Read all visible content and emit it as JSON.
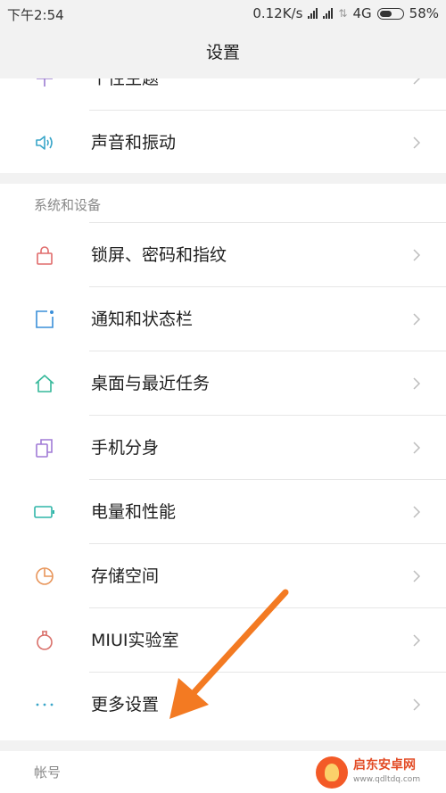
{
  "status_bar": {
    "time": "下午2:54",
    "speed": "0.12K/s",
    "network": "4G",
    "battery": "58%",
    "battery_level": 0.58
  },
  "title": "设置",
  "top_group": {
    "items": [
      {
        "label": "个性主题",
        "icon": "theme-icon",
        "color": "#9b7bd1"
      },
      {
        "label": "声音和振动",
        "icon": "speaker-icon",
        "color": "#3aa6c9"
      }
    ]
  },
  "system_section": {
    "header": "系统和设备",
    "items": [
      {
        "label": "锁屏、密码和指纹",
        "icon": "lock-icon",
        "color": "#e06b6b"
      },
      {
        "label": "通知和状态栏",
        "icon": "notification-icon",
        "color": "#3a8fd9"
      },
      {
        "label": "桌面与最近任务",
        "icon": "home-icon",
        "color": "#35b89a"
      },
      {
        "label": "手机分身",
        "icon": "dual-app-icon",
        "color": "#a07ad6"
      },
      {
        "label": "电量和性能",
        "icon": "battery-icon",
        "color": "#2fb5a8"
      },
      {
        "label": "存储空间",
        "icon": "storage-icon",
        "color": "#e8955a"
      },
      {
        "label": "MIUI实验室",
        "icon": "lab-icon",
        "color": "#d9706a"
      },
      {
        "label": "更多设置",
        "icon": "more-icon",
        "color": "#3aa6c9"
      }
    ]
  },
  "account_section": {
    "header": "帐号"
  },
  "watermark": {
    "name": "启东安卓网",
    "url": "www.qdltdq.com",
    "color": "#f35a27"
  },
  "annotation_color": "#f37a22"
}
